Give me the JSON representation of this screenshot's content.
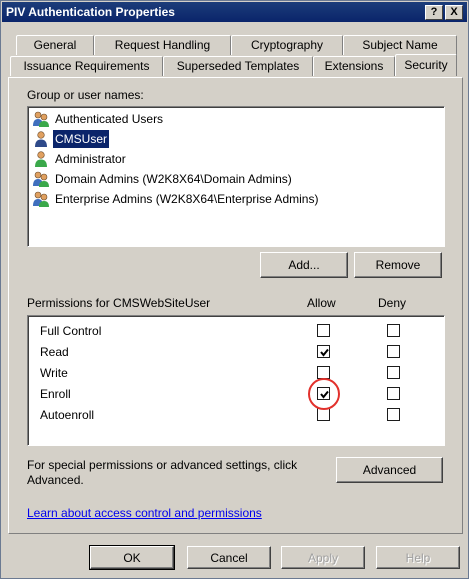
{
  "window": {
    "title": "PIV Authentication Properties",
    "help_glyph": "?",
    "close_glyph": "X"
  },
  "tabs": {
    "row1": [
      "General",
      "Request Handling",
      "Cryptography",
      "Subject Name"
    ],
    "row2": [
      "Issuance Requirements",
      "Superseded Templates",
      "Extensions",
      "Security"
    ],
    "active": "Security"
  },
  "security": {
    "group_label": "Group or user names:",
    "users": [
      {
        "name": "Authenticated Users",
        "icon": "group-icon",
        "selected": false
      },
      {
        "name": "CMSUser",
        "icon": "user-icon",
        "selected": true
      },
      {
        "name": "Administrator",
        "icon": "user-icon",
        "selected": false
      },
      {
        "name": "Domain Admins (W2K8X64\\Domain Admins)",
        "icon": "group-icon",
        "selected": false
      },
      {
        "name": "Enterprise Admins (W2K8X64\\Enterprise Admins)",
        "icon": "group-icon",
        "selected": false
      }
    ],
    "add_label": "Add...",
    "remove_label": "Remove",
    "permissions_label": "Permissions for CMSWebSiteUser",
    "allow_header": "Allow",
    "deny_header": "Deny",
    "permissions": [
      {
        "name": "Full Control",
        "allow": false,
        "deny": false
      },
      {
        "name": "Read",
        "allow": true,
        "deny": false
      },
      {
        "name": "Write",
        "allow": false,
        "deny": false
      },
      {
        "name": "Enroll",
        "allow": true,
        "deny": false
      },
      {
        "name": "Autoenroll",
        "allow": false,
        "deny": false
      }
    ],
    "special_text_line1": "For special permissions or advanced settings, click",
    "special_text_line2": "Advanced.",
    "advanced_label": "Advanced",
    "learn_link": "Learn about access control and permissions"
  },
  "footer": {
    "ok_label": "OK",
    "cancel_label": "Cancel",
    "apply_label": "Apply",
    "help_label": "Help"
  },
  "colors": {
    "selection": "#0a246a",
    "highlight_circle": "#e2312c",
    "link": "#0000ee"
  }
}
